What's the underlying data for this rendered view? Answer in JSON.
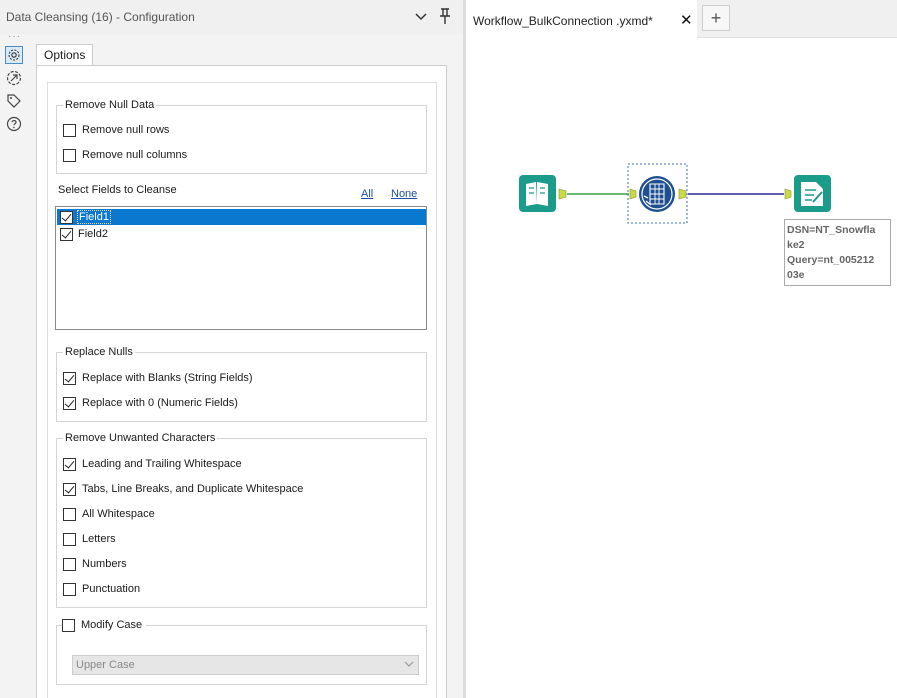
{
  "config_pane": {
    "title": "Data Cleansing (16) - Configuration",
    "side_dots": "···",
    "options_tab": "Options",
    "remove_null_data": {
      "title": "Remove Null Data",
      "remove_null_rows": "Remove null rows",
      "remove_null_columns": "Remove null columns"
    },
    "select_fields": {
      "title": "Select Fields to Cleanse",
      "all_link": "All",
      "none_link": "None",
      "fields": [
        "Field1",
        "Field2"
      ]
    },
    "replace_nulls": {
      "title": "Replace Nulls",
      "blanks": "Replace with Blanks (String Fields)",
      "zero": "Replace with 0 (Numeric Fields)"
    },
    "remove_unwanted": {
      "title": "Remove Unwanted Characters",
      "leading_trailing": "Leading and Trailing Whitespace",
      "tabs_breaks": "Tabs, Line Breaks, and Duplicate Whitespace",
      "all_whitespace": "All Whitespace",
      "letters": "Letters",
      "numbers": "Numbers",
      "punctuation": "Punctuation"
    },
    "modify_case": {
      "title": "Modify Case",
      "selected": "Upper Case"
    }
  },
  "canvas": {
    "tab_label": "Workflow_BulkConnection .yxmd*",
    "tab_close": "✕",
    "new_tab": "+",
    "annotation": {
      "line1": "DSN=NT_Snowfla",
      "line2": "ke2",
      "line3": "Query=nt_005212",
      "line4": "03e"
    }
  },
  "colors": {
    "tool_teal": "#1b9b8a",
    "tool_blue": "#1d4f91",
    "selection_blue": "#0b78d0",
    "link_blue": "#1a4ea0"
  },
  "icons": [
    "gear-icon",
    "connection-icon",
    "tag-icon",
    "help-icon",
    "chevron-down-icon",
    "pin-icon",
    "close-icon",
    "plus-icon",
    "input-book-icon",
    "data-cleansing-icon",
    "output-data-icon"
  ]
}
